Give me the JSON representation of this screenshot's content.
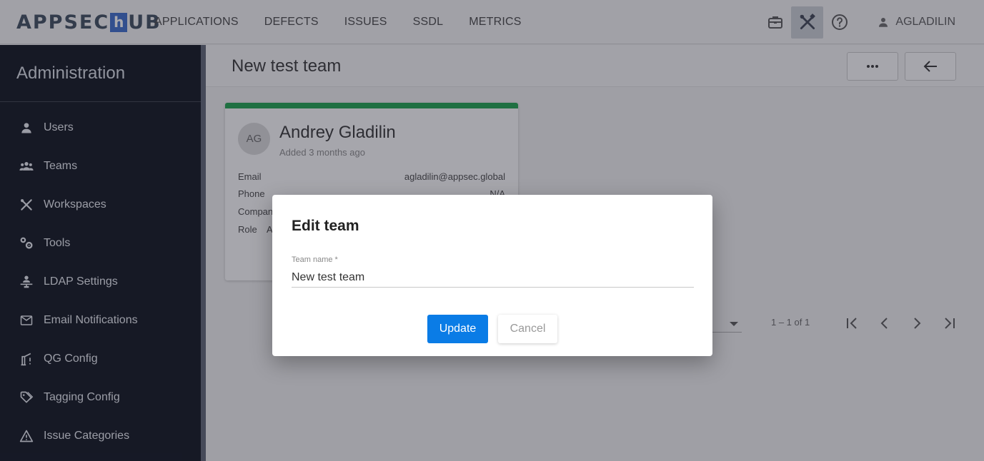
{
  "app": {
    "logo_left": "APPSEC",
    "logo_h": "h",
    "logo_right": "UB"
  },
  "nav": [
    "APPLICATIONS",
    "DEFECTS",
    "ISSUES",
    "SSDL",
    "METRICS"
  ],
  "top_icons": [
    "briefcase-icon",
    "tools-icon",
    "help-icon"
  ],
  "user": {
    "name": "AGLADILIN"
  },
  "sidebar": {
    "title": "Administration",
    "items": [
      {
        "label": "Users",
        "icon": "user-icon"
      },
      {
        "label": "Teams",
        "icon": "group-icon"
      },
      {
        "label": "Workspaces",
        "icon": "tools-icon"
      },
      {
        "label": "Tools",
        "icon": "gears-icon"
      },
      {
        "label": "LDAP Settings",
        "icon": "ldap-icon"
      },
      {
        "label": "Email Notifications",
        "icon": "mail-icon"
      },
      {
        "label": "QG Config",
        "icon": "gate-icon"
      },
      {
        "label": "Tagging Config",
        "icon": "tag-icon"
      },
      {
        "label": "Issue Categories",
        "icon": "warning-icon"
      }
    ]
  },
  "main": {
    "title": "New test team",
    "card": {
      "initials": "AG",
      "name": "Andrey Gladilin",
      "added": "Added 3 months ago",
      "email_label": "Email",
      "email": "agladilin@appsec.global",
      "phone_label": "Phone",
      "phone": "N/A",
      "company_label": "Compan",
      "role_label": "Role",
      "role_partial": "A"
    },
    "pager": {
      "range": "1 – 1 of 1"
    }
  },
  "dialog": {
    "title": "Edit team",
    "field_label": "Team name *",
    "field_value": "New test team",
    "update_label": "Update",
    "cancel_label": "Cancel"
  },
  "colors": {
    "accent": "#0a7ce6",
    "card_top": "#1aa04a",
    "sidebar_bg": "#0a0f1a"
  }
}
